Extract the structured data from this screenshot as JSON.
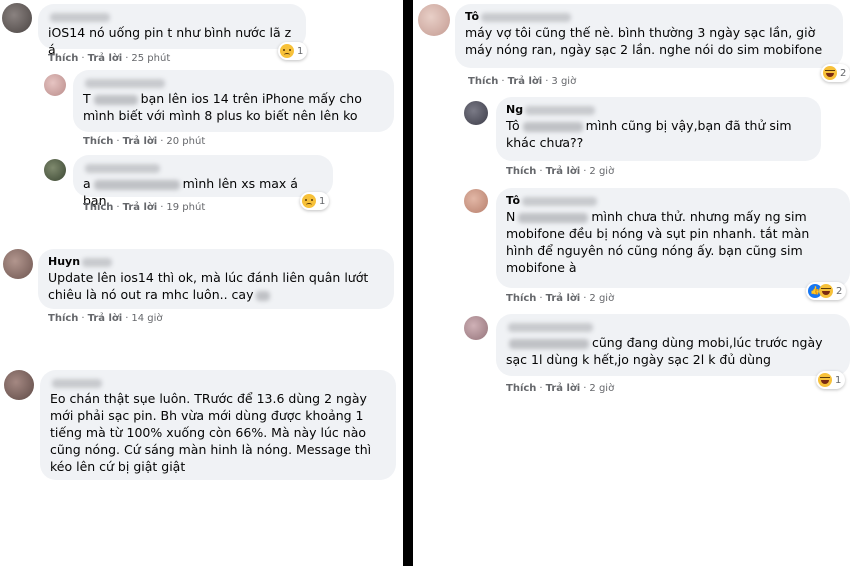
{
  "actions": {
    "like": "Thích",
    "reply": "Trả lời",
    "sep": "·"
  },
  "left": [
    {
      "name": "",
      "text": "iOS14 nó uống pin t như bình nước lã z á",
      "time": "25 phút",
      "reaction": "sad",
      "reaction_count": "1"
    },
    {
      "name": "",
      "mention": "T",
      "text": "bạn lên ios 14 trên iPhone mấy cho mình biết với mình 8 plus ko biết nên lên ko",
      "time": "20 phút"
    },
    {
      "name": "",
      "mention": "a",
      "text": "mình lên xs max á bạn",
      "time": "19 phút",
      "reaction": "sad",
      "reaction_count": "1"
    },
    {
      "name": "Huyn",
      "text": "Update lên ios14 thì ok, mà lúc đánh liên quân lướt chiêu là nó out ra mhc luôn.. cay",
      "time": "14 giờ"
    },
    {
      "name": "",
      "text": "Eo chán thật sụe luôn. TRước để 13.6 dùng 2 ngày mới phải sạc pin. Bh vừa mới dùng được khoảng 1 tiếng mà từ 100% xuống còn 66%. Mà này lúc nào cũng nóng. Cứ sáng màn hinh là nóng. Message thì kéo lên cứ bị giật giật"
    }
  ],
  "right": [
    {
      "name": "Tô",
      "text": "máy vợ tôi cũng thế nè. bình thường 3 ngày sạc lần, giờ máy nóng ran, ngày sạc 2 lần. nghe nói do sim mobifone",
      "time": "3 giờ",
      "reaction": "haha",
      "reaction_count": "2"
    },
    {
      "name": "Ng",
      "mention": "Tô",
      "text": "mình cũng bị vậy,bạn đã thử sim khác chưa??",
      "time": "2 giờ"
    },
    {
      "name": "Tô",
      "mention": "N",
      "text": "mình chưa thử. nhưng mấy ng sim mobifone đều bị nóng và sụt pin nhanh. tắt màn hình để nguyên nó cũng nóng ấy. bạn cũng sim mobifone à",
      "time": "2 giờ",
      "reaction": "like-haha",
      "reaction_count": "2"
    },
    {
      "name": "",
      "text": "cũng đang dùng mobi,lúc trước ngày sạc 1l dùng k hết,jo ngày sạc 2l k đủ dùng",
      "time": "2 giờ",
      "reaction": "haha",
      "reaction_count": "1"
    }
  ],
  "colors": {
    "bubble": "#f0f2f5",
    "divider": "#000000",
    "meta": "#65676b",
    "reaction_yellow": "#f7c13a",
    "like_blue": "#1877f2"
  }
}
